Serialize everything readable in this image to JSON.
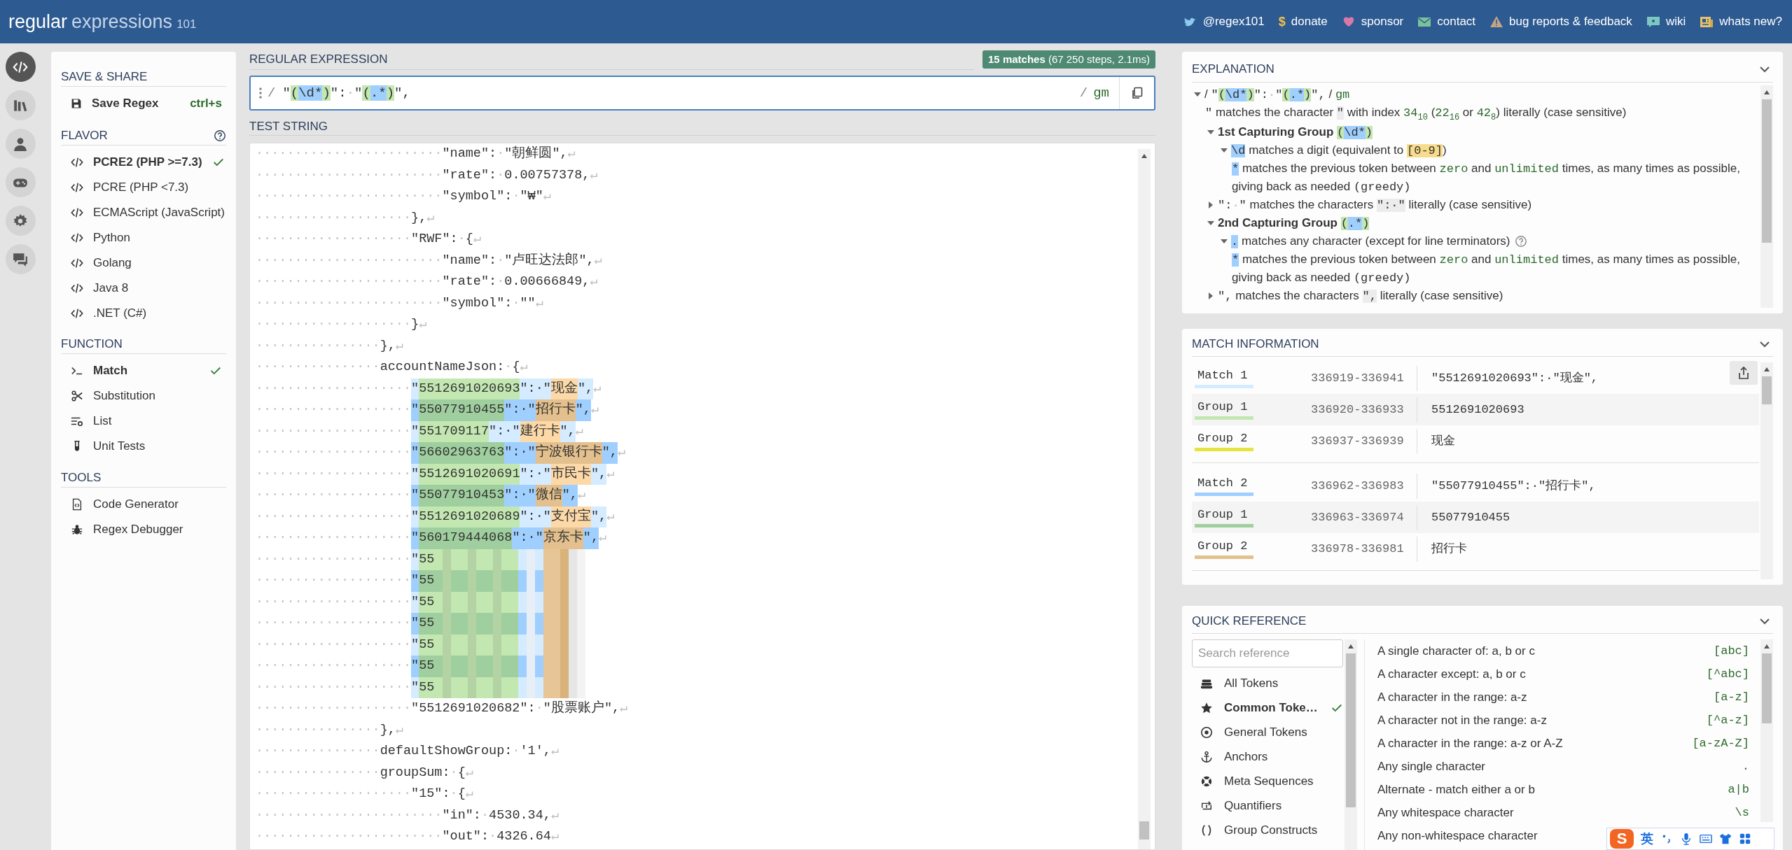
{
  "header": {
    "logo": {
      "main": "regular",
      "sub": "expressions",
      "version": "101"
    },
    "links": [
      {
        "text": "@regex101"
      },
      {
        "glyph": "$",
        "text": "donate"
      },
      {
        "text": "sponsor"
      },
      {
        "text": "contact"
      },
      {
        "text": "bug reports & feedback"
      },
      {
        "text": "wiki"
      },
      {
        "text": "whats new?"
      }
    ]
  },
  "rail": [
    {
      "selected": true
    },
    {
      "selected": false
    },
    {
      "selected": false
    },
    {
      "selected": false
    },
    {
      "selected": false
    },
    {
      "selected": false
    }
  ],
  "sidebar": {
    "sections": [
      {
        "kind": "save",
        "title": "SAVE & SHARE",
        "items": [
          {
            "label": "Save Regex",
            "shortcut": "ctrl+s"
          }
        ]
      },
      {
        "kind": "flavor",
        "title": "FLAVOR",
        "help": true,
        "items": [
          {
            "label": "PCRE2 (PHP >=7.3)",
            "selected": true
          },
          {
            "label": "PCRE (PHP <7.3)",
            "selected": false
          },
          {
            "label": "ECMAScript (JavaScript)",
            "selected": false
          },
          {
            "label": "Python",
            "selected": false
          },
          {
            "label": "Golang",
            "selected": false
          },
          {
            "label": "Java 8",
            "selected": false
          },
          {
            "label": ".NET (C#)",
            "selected": false
          }
        ]
      },
      {
        "kind": "function",
        "title": "FUNCTION",
        "items": [
          {
            "label": "Match",
            "selected": true
          },
          {
            "label": "Substitution",
            "selected": false
          },
          {
            "label": "List",
            "selected": false
          },
          {
            "label": "Unit Tests",
            "selected": false
          }
        ]
      },
      {
        "kind": "tools",
        "title": "TOOLS",
        "items": [
          {
            "label": "Code Generator"
          },
          {
            "label": "Regex Debugger"
          }
        ]
      }
    ]
  },
  "regex": {
    "title": "REGULAR EXPRESSION",
    "status": "**15 matches** (67 250 steps, 2.1ms)",
    "open_delimiter": "/",
    "close_delimiter": "/",
    "flags": "gm",
    "pattern": [
      {
        "kind": "code",
        "text": "\""
      },
      {
        "kind": "hl_green",
        "text": "("
      },
      {
        "kind": "hl_blue",
        "text": "\\d*"
      },
      {
        "kind": "hl_green",
        "text": ")"
      },
      {
        "kind": "code",
        "text": "\":"
      },
      {
        "kind": "ws",
        "text": "·"
      },
      {
        "kind": "code",
        "text": "\""
      },
      {
        "kind": "hl_green",
        "text": "("
      },
      {
        "kind": "hl_blue",
        "text": ".*"
      },
      {
        "kind": "hl_green",
        "text": ")"
      },
      {
        "kind": "code",
        "text": "\","
      }
    ]
  },
  "test_string": {
    "title": "TEST STRING",
    "lines": [
      {
        "parts": [
          {
            "kind": "ws",
            "text": "························"
          },
          {
            "kind": "code",
            "text": "\"name\":"
          },
          {
            "kind": "ws",
            "text": "·"
          },
          {
            "kind": "code",
            "text": "\"朝鲜圆\","
          },
          {
            "kind": "ws",
            "text": "↵"
          }
        ]
      },
      {
        "parts": [
          {
            "kind": "ws",
            "text": "························"
          },
          {
            "kind": "code",
            "text": "\"rate\":"
          },
          {
            "kind": "ws",
            "text": "·"
          },
          {
            "kind": "code",
            "text": "0.00757378,"
          },
          {
            "kind": "ws",
            "text": "↵"
          }
        ]
      },
      {
        "parts": [
          {
            "kind": "ws",
            "text": "························"
          },
          {
            "kind": "code",
            "text": "\"symbol\":"
          },
          {
            "kind": "ws",
            "text": "·"
          },
          {
            "kind": "code",
            "text": "\"₩\""
          },
          {
            "kind": "ws",
            "text": "↵"
          }
        ]
      },
      {
        "parts": [
          {
            "kind": "ws",
            "text": "····················"
          },
          {
            "kind": "code",
            "text": "},"
          },
          {
            "kind": "ws",
            "text": "↵"
          }
        ]
      },
      {
        "parts": [
          {
            "kind": "ws",
            "text": "····················"
          },
          {
            "kind": "code",
            "text": "\"RWF\":"
          },
          {
            "kind": "ws",
            "text": "·"
          },
          {
            "kind": "code",
            "text": "{"
          },
          {
            "kind": "ws",
            "text": "↵"
          }
        ]
      },
      {
        "parts": [
          {
            "kind": "ws",
            "text": "························"
          },
          {
            "kind": "code",
            "text": "\"name\":"
          },
          {
            "kind": "ws",
            "text": "·"
          },
          {
            "kind": "code",
            "text": "\"卢旺达法郎\","
          },
          {
            "kind": "ws",
            "text": "↵"
          }
        ]
      },
      {
        "parts": [
          {
            "kind": "ws",
            "text": "························"
          },
          {
            "kind": "code",
            "text": "\"rate\":"
          },
          {
            "kind": "ws",
            "text": "·"
          },
          {
            "kind": "code",
            "text": "0.00666849,"
          },
          {
            "kind": "ws",
            "text": "↵"
          }
        ]
      },
      {
        "parts": [
          {
            "kind": "ws",
            "text": "························"
          },
          {
            "kind": "code",
            "text": "\"symbol\":"
          },
          {
            "kind": "ws",
            "text": "·"
          },
          {
            "kind": "code",
            "text": "\"\""
          },
          {
            "kind": "ws",
            "text": "↵"
          }
        ]
      },
      {
        "parts": [
          {
            "kind": "ws",
            "text": "····················"
          },
          {
            "kind": "code",
            "text": "}"
          },
          {
            "kind": "ws",
            "text": "↵"
          }
        ]
      },
      {
        "parts": [
          {
            "kind": "ws",
            "text": "················"
          },
          {
            "kind": "code",
            "text": "},"
          },
          {
            "kind": "ws",
            "text": "↵"
          }
        ]
      },
      {
        "parts": [
          {
            "kind": "ws",
            "text": "················"
          },
          {
            "kind": "code",
            "text": "accountNameJson:"
          },
          {
            "kind": "ws",
            "text": "·"
          },
          {
            "kind": "code",
            "text": "{"
          },
          {
            "kind": "ws",
            "text": "↵"
          }
        ]
      },
      {
        "parts": [
          {
            "kind": "ws",
            "text": "····················"
          },
          {
            "kind": "hl",
            "text": "\"",
            "color": "#d5ebff"
          },
          {
            "kind": "hl",
            "text": "5512691020693",
            "color": "#c3e7b1"
          },
          {
            "kind": "hl",
            "text": "\":·\"",
            "color": "#d5ebff"
          },
          {
            "kind": "hl",
            "text": "现金",
            "color": "#fcd9a7"
          },
          {
            "kind": "hl",
            "text": "\",",
            "color": "#d5ebff"
          },
          {
            "kind": "ws",
            "text": "↵"
          }
        ]
      },
      {
        "parts": [
          {
            "kind": "ws",
            "text": "····················"
          },
          {
            "kind": "hl",
            "text": "\"",
            "color": "#9fcfff"
          },
          {
            "kind": "hl",
            "text": "55077910455",
            "color": "#9fcf9f"
          },
          {
            "kind": "hl",
            "text": "\":·\"",
            "color": "#9fcfff"
          },
          {
            "kind": "hl",
            "text": "招行卡",
            "color": "#e3c08d"
          },
          {
            "kind": "hl",
            "text": "\",",
            "color": "#9fcfff"
          },
          {
            "kind": "ws",
            "text": "↵"
          }
        ]
      },
      {
        "parts": [
          {
            "kind": "ws",
            "text": "····················"
          },
          {
            "kind": "hl",
            "text": "\"",
            "color": "#d5ebff"
          },
          {
            "kind": "hl",
            "text": "551709117",
            "color": "#c3e7b1"
          },
          {
            "kind": "hl",
            "text": "\":·\"",
            "color": "#d5ebff"
          },
          {
            "kind": "hl",
            "text": "建行卡",
            "color": "#fcd9a7"
          },
          {
            "kind": "hl",
            "text": "\",",
            "color": "#d5ebff"
          },
          {
            "kind": "ws",
            "text": "↵"
          }
        ]
      },
      {
        "parts": [
          {
            "kind": "ws",
            "text": "····················"
          },
          {
            "kind": "hl",
            "text": "\"",
            "color": "#9fcfff"
          },
          {
            "kind": "hl",
            "text": "56602963763",
            "color": "#9fcf9f"
          },
          {
            "kind": "hl",
            "text": "\":·\"",
            "color": "#9fcfff"
          },
          {
            "kind": "hl",
            "text": "宁波银行卡",
            "color": "#e3c08d"
          },
          {
            "kind": "hl",
            "text": "\",",
            "color": "#9fcfff"
          },
          {
            "kind": "ws",
            "text": "↵"
          }
        ]
      },
      {
        "parts": [
          {
            "kind": "ws",
            "text": "····················"
          },
          {
            "kind": "hl",
            "text": "\"",
            "color": "#d5ebff"
          },
          {
            "kind": "hl",
            "text": "5512691020691",
            "color": "#c3e7b1"
          },
          {
            "kind": "hl",
            "text": "\":·\"",
            "color": "#d5ebff"
          },
          {
            "kind": "hl",
            "text": "市民卡",
            "color": "#fcd9a7"
          },
          {
            "kind": "hl",
            "text": "\",",
            "color": "#d5ebff"
          },
          {
            "kind": "ws",
            "text": "↵"
          }
        ]
      },
      {
        "parts": [
          {
            "kind": "ws",
            "text": "····················"
          },
          {
            "kind": "hl",
            "text": "\"",
            "color": "#9fcfff"
          },
          {
            "kind": "hl",
            "text": "55077910453",
            "color": "#9fcf9f"
          },
          {
            "kind": "hl",
            "text": "\":·\"",
            "color": "#9fcfff"
          },
          {
            "kind": "hl",
            "text": "微信",
            "color": "#e3c08d"
          },
          {
            "kind": "hl",
            "text": "\",",
            "color": "#9fcfff"
          },
          {
            "kind": "ws",
            "text": "↵"
          }
        ]
      },
      {
        "parts": [
          {
            "kind": "ws",
            "text": "····················"
          },
          {
            "kind": "hl",
            "text": "\"",
            "color": "#d5ebff"
          },
          {
            "kind": "hl",
            "text": "5512691020689",
            "color": "#c3e7b1"
          },
          {
            "kind": "hl",
            "text": "\":·\"",
            "color": "#d5ebff"
          },
          {
            "kind": "hl",
            "text": "支付宝",
            "color": "#fcd9a7"
          },
          {
            "kind": "hl",
            "text": "\",",
            "color": "#d5ebff"
          },
          {
            "kind": "ws",
            "text": "↵"
          }
        ]
      },
      {
        "parts": [
          {
            "kind": "ws",
            "text": "····················"
          },
          {
            "kind": "hl",
            "text": "\"",
            "color": "#9fcfff"
          },
          {
            "kind": "hl",
            "text": "560179444068",
            "color": "#9fcf9f"
          },
          {
            "kind": "hl",
            "text": "\":·\"",
            "color": "#9fcfff"
          },
          {
            "kind": "hl",
            "text": "京东卡",
            "color": "#e3c08d"
          },
          {
            "kind": "hl",
            "text": "\",",
            "color": "#9fcfff"
          },
          {
            "kind": "ws",
            "text": "↵"
          }
        ]
      },
      {
        "redacted": true,
        "parts": [
          {
            "kind": "ws",
            "text": "····················"
          },
          {
            "kind": "hl",
            "text": "\"",
            "color": "#d5ebff"
          },
          {
            "kind": "hl",
            "text": "55",
            "color": "#c3e7b1"
          }
        ]
      },
      {
        "redacted": true,
        "parts": [
          {
            "kind": "ws",
            "text": "····················"
          },
          {
            "kind": "hl",
            "text": "\"",
            "color": "#9fcfff"
          },
          {
            "kind": "hl",
            "text": "55",
            "color": "#9fcf9f"
          }
        ]
      },
      {
        "redacted": true,
        "parts": [
          {
            "kind": "ws",
            "text": "····················"
          },
          {
            "kind": "hl",
            "text": "\"",
            "color": "#d5ebff"
          },
          {
            "kind": "hl",
            "text": "55",
            "color": "#c3e7b1"
          }
        ]
      },
      {
        "redacted": true,
        "parts": [
          {
            "kind": "ws",
            "text": "····················"
          },
          {
            "kind": "hl",
            "text": "\"",
            "color": "#9fcfff"
          },
          {
            "kind": "hl",
            "text": "55",
            "color": "#9fcf9f"
          }
        ]
      },
      {
        "redacted": true,
        "parts": [
          {
            "kind": "ws",
            "text": "····················"
          },
          {
            "kind": "hl",
            "text": "\"",
            "color": "#d5ebff"
          },
          {
            "kind": "hl",
            "text": "55",
            "color": "#c3e7b1"
          }
        ]
      },
      {
        "redacted": true,
        "parts": [
          {
            "kind": "ws",
            "text": "····················"
          },
          {
            "kind": "hl",
            "text": "\"",
            "color": "#9fcfff"
          },
          {
            "kind": "hl",
            "text": "55",
            "color": "#9fcf9f"
          }
        ]
      },
      {
        "redacted": true,
        "parts": [
          {
            "kind": "ws",
            "text": "····················"
          },
          {
            "kind": "hl",
            "text": "\"",
            "color": "#d5ebff"
          },
          {
            "kind": "hl",
            "text": "55",
            "color": "#c3e7b1"
          }
        ]
      },
      {
        "parts": [
          {
            "kind": "ws",
            "text": "····················"
          },
          {
            "kind": "code",
            "text": "\"5512691020682\":"
          },
          {
            "kind": "ws",
            "text": "·"
          },
          {
            "kind": "code",
            "text": "\"股票账户\","
          },
          {
            "kind": "ws",
            "text": "↵"
          }
        ]
      },
      {
        "parts": [
          {
            "kind": "ws",
            "text": "················"
          },
          {
            "kind": "code",
            "text": "},"
          },
          {
            "kind": "ws",
            "text": "↵"
          }
        ]
      },
      {
        "parts": [
          {
            "kind": "ws",
            "text": "················"
          },
          {
            "kind": "code",
            "text": "defaultShowGroup:"
          },
          {
            "kind": "ws",
            "text": "·"
          },
          {
            "kind": "code",
            "text": "'1',"
          },
          {
            "kind": "ws",
            "text": "↵"
          }
        ]
      },
      {
        "parts": [
          {
            "kind": "ws",
            "text": "················"
          },
          {
            "kind": "code",
            "text": "groupSum:"
          },
          {
            "kind": "ws",
            "text": "·"
          },
          {
            "kind": "code",
            "text": "{"
          },
          {
            "kind": "ws",
            "text": "↵"
          }
        ]
      },
      {
        "parts": [
          {
            "kind": "ws",
            "text": "····················"
          },
          {
            "kind": "code",
            "text": "\"15\":"
          },
          {
            "kind": "ws",
            "text": "·"
          },
          {
            "kind": "code",
            "text": "{"
          },
          {
            "kind": "ws",
            "text": "↵"
          }
        ]
      },
      {
        "parts": [
          {
            "kind": "ws",
            "text": "························"
          },
          {
            "kind": "code",
            "text": "\"in\":"
          },
          {
            "kind": "ws",
            "text": "·"
          },
          {
            "kind": "code",
            "text": "4530.34,"
          },
          {
            "kind": "ws",
            "text": "↵"
          }
        ]
      },
      {
        "parts": [
          {
            "kind": "ws",
            "text": "························"
          },
          {
            "kind": "code",
            "text": "\"out\":"
          },
          {
            "kind": "ws",
            "text": "·"
          },
          {
            "kind": "code",
            "text": "4326.64"
          },
          {
            "kind": "ws",
            "text": "↵"
          }
        ]
      }
    ]
  },
  "explanation": {
    "title": "EXPLANATION",
    "tree": {
      "expanded": true,
      "segments": [
        {
          "kind": "text",
          "text": "/ "
        },
        {
          "kind": "code",
          "text": "\""
        },
        {
          "kind": "hl_green",
          "text": "("
        },
        {
          "kind": "hl_blue",
          "text": "\\d*"
        },
        {
          "kind": "hl_green",
          "text": ")"
        },
        {
          "kind": "code",
          "text": "\":"
        },
        {
          "kind": "ws",
          "text": "·"
        },
        {
          "kind": "code",
          "text": "\""
        },
        {
          "kind": "hl_green",
          "text": "("
        },
        {
          "kind": "hl_blue",
          "text": ".*"
        },
        {
          "kind": "hl_green",
          "text": ")"
        },
        {
          "kind": "code",
          "text": "\","
        },
        {
          "kind": "text",
          "text": " / "
        },
        {
          "kind": "green",
          "text": "gm"
        }
      ],
      "children": [
        {
          "segments": [
            {
              "kind": "code",
              "text": "\""
            },
            {
              "kind": "text",
              "text": " matches the character "
            },
            {
              "kind": "hl_gray",
              "text": "\""
            },
            {
              "kind": "text",
              "text": " with index "
            },
            {
              "kind": "green",
              "text": "34"
            },
            {
              "kind": "sub",
              "text": "10"
            },
            {
              "kind": "text",
              "text": " ("
            },
            {
              "kind": "green",
              "text": "22"
            },
            {
              "kind": "sub",
              "text": "16"
            },
            {
              "kind": "text",
              "text": " or "
            },
            {
              "kind": "green",
              "text": "42"
            },
            {
              "kind": "sub",
              "text": "8"
            },
            {
              "kind": "text",
              "text": ") literally (case sensitive)"
            }
          ]
        },
        {
          "expanded": true,
          "segments": [
            {
              "kind": "bold",
              "text": "1st Capturing Group "
            },
            {
              "kind": "hl_green",
              "text": "("
            },
            {
              "kind": "hl_blue",
              "text": "\\d*"
            },
            {
              "kind": "hl_green",
              "text": ")"
            }
          ],
          "children": [
            {
              "expanded": true,
              "segments": [
                {
                  "kind": "hl_blue",
                  "text": "\\d"
                },
                {
                  "kind": "text",
                  "text": " matches a digit (equivalent to "
                },
                {
                  "kind": "hl_yellow",
                  "text": "[0-9]"
                },
                {
                  "kind": "text",
                  "text": ")"
                }
              ],
              "children": [
                {
                  "segments": [
                    {
                      "kind": "hl_blue",
                      "text": "*"
                    },
                    {
                      "kind": "text",
                      "text": " matches the previous token between "
                    },
                    {
                      "kind": "green",
                      "text": "zero"
                    },
                    {
                      "kind": "text",
                      "text": " and "
                    },
                    {
                      "kind": "green",
                      "text": "unlimited"
                    },
                    {
                      "kind": "text",
                      "text": " times, as many times as possible, giving back as needed "
                    },
                    {
                      "kind": "code",
                      "text": "(greedy)"
                    }
                  ]
                }
              ]
            }
          ]
        },
        {
          "expanded": false,
          "segments": [
            {
              "kind": "code",
              "text": "\":"
            },
            {
              "kind": "ws",
              "text": "·"
            },
            {
              "kind": "code",
              "text": "\""
            },
            {
              "kind": "text",
              "text": " matches the characters "
            },
            {
              "kind": "hl_gray",
              "text": "\":·\""
            },
            {
              "kind": "text",
              "text": " literally (case sensitive)"
            }
          ]
        },
        {
          "expanded": true,
          "segments": [
            {
              "kind": "bold",
              "text": "2nd Capturing Group "
            },
            {
              "kind": "hl_green",
              "text": "("
            },
            {
              "kind": "hl_blue",
              "text": ".*"
            },
            {
              "kind": "hl_green",
              "text": ")"
            }
          ],
          "children": [
            {
              "expanded": true,
              "help": true,
              "segments": [
                {
                  "kind": "hl_blue",
                  "text": "."
                },
                {
                  "kind": "text",
                  "text": " matches any character (except for line terminators)"
                }
              ],
              "children": [
                {
                  "segments": [
                    {
                      "kind": "hl_blue",
                      "text": "*"
                    },
                    {
                      "kind": "text",
                      "text": " matches the previous token between "
                    },
                    {
                      "kind": "green",
                      "text": "zero"
                    },
                    {
                      "kind": "text",
                      "text": " and "
                    },
                    {
                      "kind": "green",
                      "text": "unlimited"
                    },
                    {
                      "kind": "text",
                      "text": " times, as many times as possible, giving back as needed "
                    },
                    {
                      "kind": "code",
                      "text": "(greedy)"
                    }
                  ]
                }
              ]
            }
          ]
        },
        {
          "expanded": false,
          "segments": [
            {
              "kind": "code",
              "text": "\","
            },
            {
              "kind": "text",
              "text": " matches the characters "
            },
            {
              "kind": "hl_gray",
              "text": "\","
            },
            {
              "kind": "text",
              "text": " literally (case sensitive)"
            }
          ]
        }
      ]
    }
  },
  "match_information": {
    "title": "MATCH INFORMATION",
    "blocks": [
      {
        "rows": [
          {
            "label": "Match 1",
            "range": "336919-336941",
            "value": "\"5512691020693\":·\"现金\",",
            "color": "#d5ebff"
          },
          {
            "label": "Group 1",
            "range": "336920-336933",
            "value": "5512691020693",
            "color": "#c3e7b1"
          },
          {
            "label": "Group 2",
            "range": "336937-336939",
            "value": "现金",
            "color": "#e5e53f"
          }
        ]
      },
      {
        "rows": [
          {
            "label": "Match 2",
            "range": "336962-336983",
            "value": "\"55077910455\":·\"招行卡\",",
            "color": "#9fcfff"
          },
          {
            "label": "Group 1",
            "range": "336963-336974",
            "value": "55077910455",
            "color": "#9fcf9f"
          },
          {
            "label": "Group 2",
            "range": "336978-336981",
            "value": "招行卡",
            "color": "#e3c08d"
          }
        ]
      }
    ]
  },
  "quick_reference": {
    "title": "QUICK REFERENCE",
    "search_placeholder": "Search reference",
    "categories": [
      {
        "label": "All Tokens",
        "selected": false
      },
      {
        "label": "Common Toke…",
        "selected": true
      },
      {
        "label": "General Tokens",
        "selected": false
      },
      {
        "label": "Anchors",
        "selected": false
      },
      {
        "label": "Meta Sequences",
        "selected": false
      },
      {
        "label": "Quantifiers",
        "selected": false
      },
      {
        "label": "Group Constructs",
        "selected": false
      }
    ],
    "entries": [
      {
        "description": "A single character of: a, b or c",
        "token": "[abc]"
      },
      {
        "description": "A character except: a, b or c",
        "token": "[^abc]"
      },
      {
        "description": "A character in the range: a-z",
        "token": "[a-z]"
      },
      {
        "description": "A character not in the range: a-z",
        "token": "[^a-z]"
      },
      {
        "description": "A character in the range: a-z or A-Z",
        "token": "[a-zA-Z]"
      },
      {
        "description": "Any single character",
        "token": "."
      },
      {
        "description": "Alternate - match either a or b",
        "token": "a|b"
      },
      {
        "description": "Any whitespace character",
        "token": "\\s"
      },
      {
        "description": "Any non-whitespace character"
      }
    ]
  },
  "ime_toolbar": {
    "logo": "S",
    "mode": "英"
  }
}
